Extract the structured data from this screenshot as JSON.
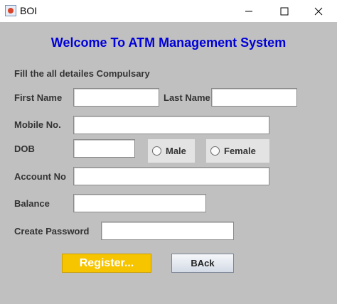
{
  "window": {
    "title": "BOI",
    "controls": {
      "minimize_icon": "minimize-icon",
      "maximize_icon": "maximize-icon",
      "close_icon": "close-icon"
    }
  },
  "form": {
    "heading": "Welcome To ATM Management System",
    "note": "Fill the all detailes Compulsary",
    "labels": {
      "first_name": "First Name",
      "last_name": "Last Name",
      "mobile": "Mobile No.",
      "dob": "DOB",
      "account_no": "Account No",
      "balance": "Balance",
      "create_password": "Create Password"
    },
    "values": {
      "first_name": "",
      "last_name": "",
      "mobile": "",
      "dob": "",
      "account_no": "",
      "balance": "",
      "create_password": ""
    },
    "gender": {
      "options": [
        "Male",
        "Female"
      ]
    },
    "buttons": {
      "register": "Register...",
      "back": "BAck"
    }
  },
  "colors": {
    "background": "#c0c0c0",
    "heading": "#0000d8",
    "register_button": "#f7c400"
  }
}
